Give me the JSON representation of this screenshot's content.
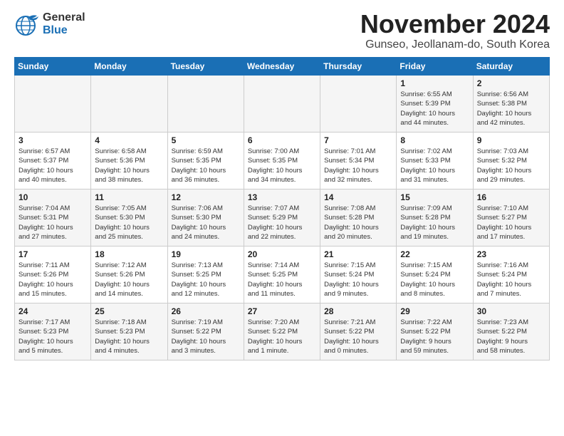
{
  "header": {
    "logo_line1": "General",
    "logo_line2": "Blue",
    "month": "November 2024",
    "location": "Gunseo, Jeollanam-do, South Korea"
  },
  "weekdays": [
    "Sunday",
    "Monday",
    "Tuesday",
    "Wednesday",
    "Thursday",
    "Friday",
    "Saturday"
  ],
  "weeks": [
    [
      {
        "day": "",
        "info": ""
      },
      {
        "day": "",
        "info": ""
      },
      {
        "day": "",
        "info": ""
      },
      {
        "day": "",
        "info": ""
      },
      {
        "day": "",
        "info": ""
      },
      {
        "day": "1",
        "info": "Sunrise: 6:55 AM\nSunset: 5:39 PM\nDaylight: 10 hours\nand 44 minutes."
      },
      {
        "day": "2",
        "info": "Sunrise: 6:56 AM\nSunset: 5:38 PM\nDaylight: 10 hours\nand 42 minutes."
      }
    ],
    [
      {
        "day": "3",
        "info": "Sunrise: 6:57 AM\nSunset: 5:37 PM\nDaylight: 10 hours\nand 40 minutes."
      },
      {
        "day": "4",
        "info": "Sunrise: 6:58 AM\nSunset: 5:36 PM\nDaylight: 10 hours\nand 38 minutes."
      },
      {
        "day": "5",
        "info": "Sunrise: 6:59 AM\nSunset: 5:35 PM\nDaylight: 10 hours\nand 36 minutes."
      },
      {
        "day": "6",
        "info": "Sunrise: 7:00 AM\nSunset: 5:35 PM\nDaylight: 10 hours\nand 34 minutes."
      },
      {
        "day": "7",
        "info": "Sunrise: 7:01 AM\nSunset: 5:34 PM\nDaylight: 10 hours\nand 32 minutes."
      },
      {
        "day": "8",
        "info": "Sunrise: 7:02 AM\nSunset: 5:33 PM\nDaylight: 10 hours\nand 31 minutes."
      },
      {
        "day": "9",
        "info": "Sunrise: 7:03 AM\nSunset: 5:32 PM\nDaylight: 10 hours\nand 29 minutes."
      }
    ],
    [
      {
        "day": "10",
        "info": "Sunrise: 7:04 AM\nSunset: 5:31 PM\nDaylight: 10 hours\nand 27 minutes."
      },
      {
        "day": "11",
        "info": "Sunrise: 7:05 AM\nSunset: 5:30 PM\nDaylight: 10 hours\nand 25 minutes."
      },
      {
        "day": "12",
        "info": "Sunrise: 7:06 AM\nSunset: 5:30 PM\nDaylight: 10 hours\nand 24 minutes."
      },
      {
        "day": "13",
        "info": "Sunrise: 7:07 AM\nSunset: 5:29 PM\nDaylight: 10 hours\nand 22 minutes."
      },
      {
        "day": "14",
        "info": "Sunrise: 7:08 AM\nSunset: 5:28 PM\nDaylight: 10 hours\nand 20 minutes."
      },
      {
        "day": "15",
        "info": "Sunrise: 7:09 AM\nSunset: 5:28 PM\nDaylight: 10 hours\nand 19 minutes."
      },
      {
        "day": "16",
        "info": "Sunrise: 7:10 AM\nSunset: 5:27 PM\nDaylight: 10 hours\nand 17 minutes."
      }
    ],
    [
      {
        "day": "17",
        "info": "Sunrise: 7:11 AM\nSunset: 5:26 PM\nDaylight: 10 hours\nand 15 minutes."
      },
      {
        "day": "18",
        "info": "Sunrise: 7:12 AM\nSunset: 5:26 PM\nDaylight: 10 hours\nand 14 minutes."
      },
      {
        "day": "19",
        "info": "Sunrise: 7:13 AM\nSunset: 5:25 PM\nDaylight: 10 hours\nand 12 minutes."
      },
      {
        "day": "20",
        "info": "Sunrise: 7:14 AM\nSunset: 5:25 PM\nDaylight: 10 hours\nand 11 minutes."
      },
      {
        "day": "21",
        "info": "Sunrise: 7:15 AM\nSunset: 5:24 PM\nDaylight: 10 hours\nand 9 minutes."
      },
      {
        "day": "22",
        "info": "Sunrise: 7:15 AM\nSunset: 5:24 PM\nDaylight: 10 hours\nand 8 minutes."
      },
      {
        "day": "23",
        "info": "Sunrise: 7:16 AM\nSunset: 5:24 PM\nDaylight: 10 hours\nand 7 minutes."
      }
    ],
    [
      {
        "day": "24",
        "info": "Sunrise: 7:17 AM\nSunset: 5:23 PM\nDaylight: 10 hours\nand 5 minutes."
      },
      {
        "day": "25",
        "info": "Sunrise: 7:18 AM\nSunset: 5:23 PM\nDaylight: 10 hours\nand 4 minutes."
      },
      {
        "day": "26",
        "info": "Sunrise: 7:19 AM\nSunset: 5:22 PM\nDaylight: 10 hours\nand 3 minutes."
      },
      {
        "day": "27",
        "info": "Sunrise: 7:20 AM\nSunset: 5:22 PM\nDaylight: 10 hours\nand 1 minute."
      },
      {
        "day": "28",
        "info": "Sunrise: 7:21 AM\nSunset: 5:22 PM\nDaylight: 10 hours\nand 0 minutes."
      },
      {
        "day": "29",
        "info": "Sunrise: 7:22 AM\nSunset: 5:22 PM\nDaylight: 9 hours\nand 59 minutes."
      },
      {
        "day": "30",
        "info": "Sunrise: 7:23 AM\nSunset: 5:22 PM\nDaylight: 9 hours\nand 58 minutes."
      }
    ]
  ]
}
